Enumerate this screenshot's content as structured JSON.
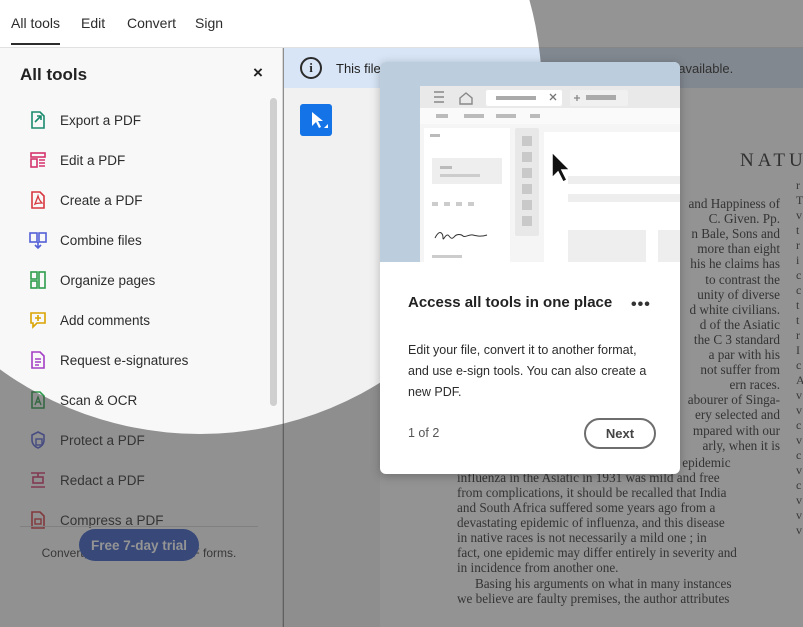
{
  "topbar": {
    "tabs": [
      {
        "label": "All tools",
        "active": true
      },
      {
        "label": "Edit"
      },
      {
        "label": "Convert"
      },
      {
        "label": "Sign"
      }
    ]
  },
  "sidebar": {
    "title": "All tools",
    "close": "×",
    "items": [
      {
        "label": "Export a PDF",
        "icon": "export-pdf-icon",
        "color": "#1a8a6e"
      },
      {
        "label": "Edit a PDF",
        "icon": "edit-pdf-icon",
        "color": "#d6336c"
      },
      {
        "label": "Create a PDF",
        "icon": "create-pdf-icon",
        "color": "#d7373f"
      },
      {
        "label": "Combine files",
        "icon": "combine-files-icon",
        "color": "#5460d6"
      },
      {
        "label": "Organize pages",
        "icon": "organize-pages-icon",
        "color": "#2d9d4b"
      },
      {
        "label": "Add comments",
        "icon": "add-comments-icon",
        "color": "#d9a400"
      },
      {
        "label": "Request e-signatures",
        "icon": "request-esign-icon",
        "color": "#a43ec4"
      },
      {
        "label": "Scan & OCR",
        "icon": "scan-ocr-icon",
        "color": "#2d9d4b"
      },
      {
        "label": "Protect a PDF",
        "icon": "protect-pdf-icon",
        "color": "#5460d6"
      },
      {
        "label": "Redact a PDF",
        "icon": "redact-pdf-icon",
        "color": "#d6336c"
      },
      {
        "label": "Compress a PDF",
        "icon": "compress-pdf-icon",
        "color": "#d7373f"
      }
    ],
    "promo_text": "Convert, edit, and e-sign PDF forms.",
    "trial_button": "Free 7-day trial"
  },
  "infobar": {
    "icon": "info-icon",
    "text": "This file has been opened read-only. Some tools may be unavailable."
  },
  "document": {
    "title": "NATU",
    "lines": [
      "and Happiness of",
      "C. Given.  Pp.",
      "n Bale, Sons and",
      "more than eight",
      "his he claims has",
      "to contrast the",
      "unity of diverse",
      "d white civilians.",
      "d of the Asiatic",
      "the C 3 standard",
      "a par with his",
      "not suffer from",
      "ern races.",
      "abourer of Singa-",
      "ery selected and",
      "mpared with our",
      "arly, when it is",
      "stated that in contrast to the European, the epidemic",
      "influenza in the Asiatic in 1931 was mild and free",
      "from complications, it should be recalled that India",
      "and South Africa suffered some years ago from a",
      "devastating epidemic of influenza, and this disease",
      "in native races is not necessarily a mild one ;  in",
      "fact, one epidemic may differ entirely in severity and",
      "in incidence from another one.",
      "Basing his arguments on what in many instances",
      "we believe are faulty premises, the author attributes"
    ],
    "gutter": "r\nT\nv\nt\nr\ni\nc\nc\nt\nt\nr\nI\nc\nA\nv\nv\nc\nv\nc\nv\nc\nv\nv\nv"
  },
  "popup": {
    "title": "Access all tools in one place",
    "more": "•••",
    "body": "Edit your file, convert it to another format, and use e-sign tools. You can also create a new PDF.",
    "count": "1 of 2",
    "next": "Next",
    "illustration_signature": "Rauu Olfau"
  },
  "colors": {
    "accent": "#1473e6",
    "trial": "#3157c4",
    "infobar": "#d7e5f6",
    "illustration_bg": "#bccddd"
  }
}
